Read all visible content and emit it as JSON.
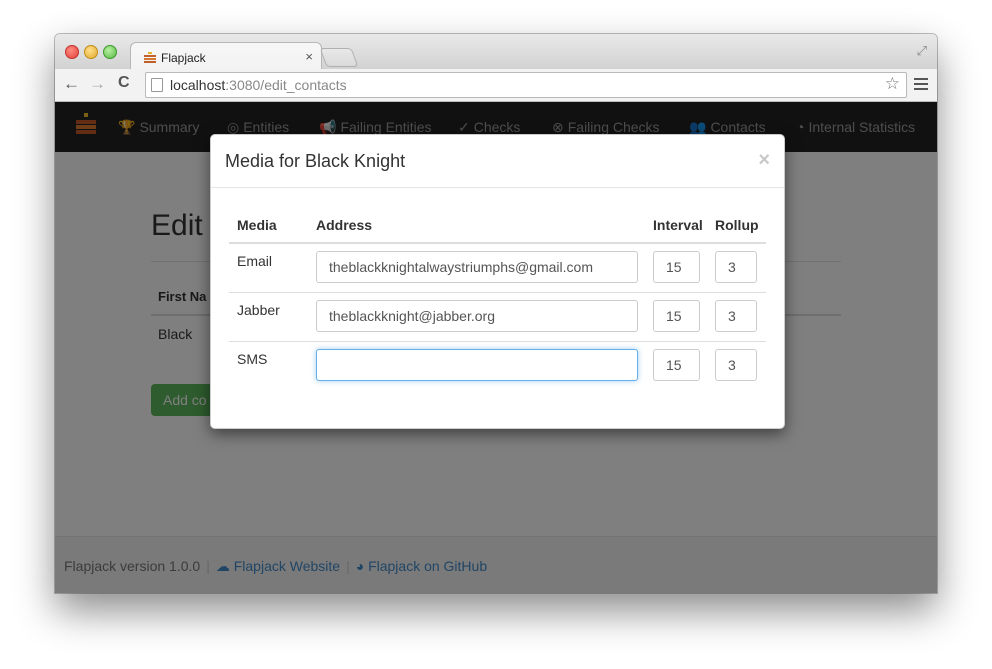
{
  "browser": {
    "tab_title": "Flapjack",
    "tab_close": "×",
    "url_host": "localhost",
    "url_rest": ":3080/edit_contacts"
  },
  "navbar": {
    "items": [
      {
        "label": "Summary",
        "icon": "trophy-icon"
      },
      {
        "label": "Entities",
        "icon": "bullseye-icon"
      },
      {
        "label": "Failing Entities",
        "icon": "bullhorn-icon"
      },
      {
        "label": "Checks",
        "icon": "check-circle-icon"
      },
      {
        "label": "Failing Checks",
        "icon": "times-circle-icon"
      },
      {
        "label": "Contacts",
        "icon": "group-icon"
      },
      {
        "label": "Internal Statistics",
        "icon": "dashboard-icon"
      }
    ]
  },
  "page": {
    "title": "Edit",
    "column_first": "First Na",
    "first_name": "Black",
    "add_button": "Add co"
  },
  "modal": {
    "title": "Media for Black Knight",
    "close": "×",
    "columns": {
      "media": "Media",
      "address": "Address",
      "interval": "Interval",
      "rollup": "Rollup"
    },
    "rows": [
      {
        "media": "Email",
        "address": "theblackknightalwaystriumphs@gmail.com",
        "interval": "15",
        "rollup": "3"
      },
      {
        "media": "Jabber",
        "address": "theblackknight@jabber.org",
        "interval": "15",
        "rollup": "3"
      },
      {
        "media": "SMS",
        "address": "",
        "interval": "15",
        "rollup": "3"
      }
    ]
  },
  "footer": {
    "version": "Flapjack version 1.0.0",
    "website_link": "Flapjack Website",
    "github_link": "Flapjack on GitHub"
  },
  "colors": {
    "navbar_bg": "#222222",
    "link": "#428bca",
    "success_button": "#5cb85c",
    "focus_border": "#66afe9"
  }
}
